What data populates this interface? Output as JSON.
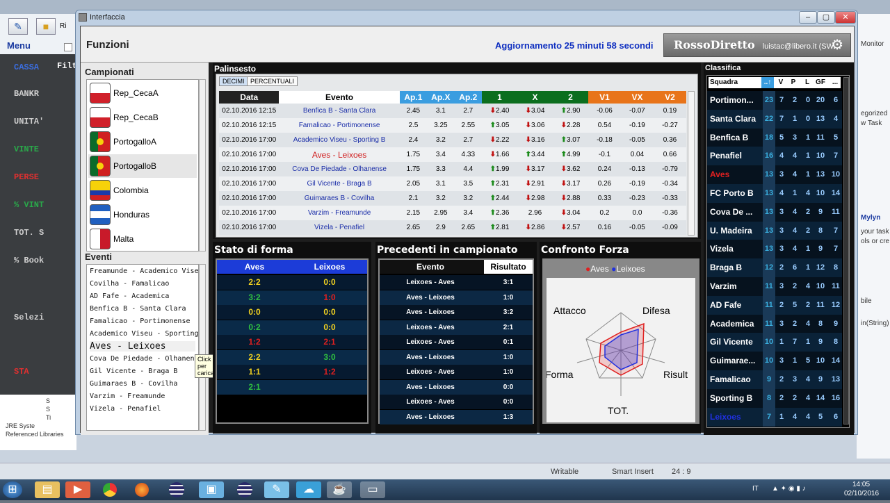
{
  "ide": {
    "menu_label": "Menu",
    "tab_fragment": "Ri",
    "filter_fragment": "Filt",
    "left_items": [
      "CASSA",
      "BANKR",
      "UNITA'",
      "VINTE",
      "PERSE",
      "% VINT",
      "TOT. S",
      "% Book",
      "Selezi",
      "STA"
    ],
    "left_colors": [
      "#3b6ee0",
      "#cfcfcf",
      "#cfcfcf",
      "#2aa84a",
      "#e03030",
      "#2aa84a",
      "#cfcfcf",
      "#cfcfcf",
      "#cfcfcf",
      "#e03030"
    ],
    "explorer_items": [
      "S",
      "S",
      "Ti",
      "JRE Syste",
      "Referenced Libraries"
    ],
    "right_items": [
      "Monitor",
      "egorized",
      "w Task",
      "Mylyn",
      "your task",
      "ols or cre",
      "bile",
      "in(String)"
    ],
    "status": {
      "writable": "Writable",
      "insert": "Smart Insert",
      "position": "24 : 9"
    },
    "clock": {
      "time": "14:05",
      "date": "02/10/2016",
      "lang": "IT"
    }
  },
  "window": {
    "title": "Interfaccia",
    "buttons": [
      "–",
      "▢",
      "✕"
    ],
    "funzioni": "Funzioni",
    "aggiornamento": "Aggiornamento 25 minuti 58 secondi",
    "logo": "RossoDiretto",
    "email": "luistac@libero.it (SW. Lab.)"
  },
  "campionati": {
    "label": "Campionati",
    "items": [
      {
        "name": "Rep_CecaA",
        "flag": "cz"
      },
      {
        "name": "Rep_CecaB",
        "flag": "cz"
      },
      {
        "name": "PortogalloA",
        "flag": "pt"
      },
      {
        "name": "PortogalloB",
        "flag": "pt",
        "selected": true
      },
      {
        "name": "Colombia",
        "flag": "co"
      },
      {
        "name": "Honduras",
        "flag": "hn"
      },
      {
        "name": "Malta",
        "flag": "mt"
      }
    ]
  },
  "eventi": {
    "label": "Eventi",
    "items": [
      "Freamunde - Academico Visei",
      "Covilha - Famalicao",
      "AD Fafe - Academica",
      "Benfica B - Santa Clara",
      "Famalicao - Portimonense",
      "Academico Viseu - Sporting",
      "Aves - Leixoes",
      "Cova De Piedade - Olhanense",
      "Gil Vicente - Braga B",
      "Guimaraes B - Covilha",
      "Varzim - Freamunde",
      "Vizela - Penafiel"
    ],
    "selected": 6,
    "tooltip": "Click per caricare"
  },
  "palinsesto": {
    "title": "Palinsesto",
    "tabs": [
      "DECIMI",
      "PERCENTUALI"
    ],
    "headers": [
      "Data",
      "Evento",
      "Ap.1",
      "Ap.X",
      "Ap.2",
      "1",
      "X",
      "2",
      "V1",
      "VX",
      "V2"
    ],
    "rows": [
      {
        "data": "02.10.2016 12:15",
        "evento": "Benfica B - Santa Clara",
        "ap1": "2.45",
        "apx": "3.1",
        "ap2": "2.7",
        "o1": "2.40",
        "d1": "dn",
        "ox": "3.04",
        "dx": "dn",
        "o2": "2.90",
        "d2": "up",
        "v1": "-0.06",
        "vx": "-0.07",
        "v2": "0.19"
      },
      {
        "data": "02.10.2016 12:15",
        "evento": "Famalicao - Portimonense",
        "ap1": "2.5",
        "apx": "3.25",
        "ap2": "2.55",
        "o1": "3.05",
        "d1": "up",
        "ox": "3.06",
        "dx": "dn",
        "o2": "2.28",
        "d2": "dn",
        "v1": "0.54",
        "vx": "-0.19",
        "v2": "-0.27"
      },
      {
        "data": "02.10.2016 17:00",
        "evento": "Academico Viseu - Sporting B",
        "ap1": "2.4",
        "apx": "3.2",
        "ap2": "2.7",
        "o1": "2.22",
        "d1": "dn",
        "ox": "3.16",
        "dx": "dn",
        "o2": "3.07",
        "d2": "up",
        "v1": "-0.18",
        "vx": "-0.05",
        "v2": "0.36"
      },
      {
        "data": "02.10.2016 17:00",
        "evento": "Aves - Leixoes",
        "red": true,
        "ap1": "1.75",
        "apx": "3.4",
        "ap2": "4.33",
        "o1": "1.66",
        "d1": "dn",
        "ox": "3.44",
        "dx": "up",
        "o2": "4.99",
        "d2": "up",
        "v1": "-0.1",
        "vx": "0.04",
        "v2": "0.66"
      },
      {
        "data": "02.10.2016 17:00",
        "evento": "Cova De Piedade - Olhanense",
        "ap1": "1.75",
        "apx": "3.3",
        "ap2": "4.4",
        "o1": "1.99",
        "d1": "up",
        "ox": "3.17",
        "dx": "dn",
        "o2": "3.62",
        "d2": "dn",
        "v1": "0.24",
        "vx": "-0.13",
        "v2": "-0.79"
      },
      {
        "data": "02.10.2016 17:00",
        "evento": "Gil Vicente - Braga B",
        "ap1": "2.05",
        "apx": "3.1",
        "ap2": "3.5",
        "o1": "2.31",
        "d1": "up",
        "ox": "2.91",
        "dx": "dn",
        "o2": "3.17",
        "d2": "dn",
        "v1": "0.26",
        "vx": "-0.19",
        "v2": "-0.34"
      },
      {
        "data": "02.10.2016 17:00",
        "evento": "Guimaraes B - Covilha",
        "ap1": "2.1",
        "apx": "3.2",
        "ap2": "3.2",
        "o1": "2.44",
        "d1": "up",
        "ox": "2.98",
        "dx": "dn",
        "o2": "2.88",
        "d2": "dn",
        "v1": "0.33",
        "vx": "-0.23",
        "v2": "-0.33"
      },
      {
        "data": "02.10.2016 17:00",
        "evento": "Varzim - Freamunde",
        "ap1": "2.15",
        "apx": "2.95",
        "ap2": "3.4",
        "o1": "2.36",
        "d1": "up",
        "ox": "2.96",
        "dx": "",
        "o2": "3.04",
        "d2": "dn",
        "v1": "0.2",
        "vx": "0.0",
        "v2": "-0.36"
      },
      {
        "data": "02.10.2016 17:00",
        "evento": "Vizela - Penafiel",
        "ap1": "2.65",
        "apx": "2.9",
        "ap2": "2.65",
        "o1": "2.81",
        "d1": "up",
        "ox": "2.86",
        "dx": "dn",
        "o2": "2.57",
        "d2": "dn",
        "v1": "0.16",
        "vx": "-0.05",
        "v2": "-0.09"
      }
    ]
  },
  "stato_forma": {
    "title": "Stato di forma",
    "headers": [
      "Aves",
      "Leixoes"
    ],
    "rows": [
      {
        "a": "2:2",
        "ac": "#f0d020",
        "b": "0:0",
        "bc": "#f0d020"
      },
      {
        "a": "3:2",
        "ac": "#30c040",
        "b": "1:0",
        "bc": "#e02020"
      },
      {
        "a": "0:0",
        "ac": "#f0d020",
        "b": "0:0",
        "bc": "#f0d020"
      },
      {
        "a": "0:2",
        "ac": "#30c040",
        "b": "0:0",
        "bc": "#f0d020"
      },
      {
        "a": "1:2",
        "ac": "#e02020",
        "b": "2:1",
        "bc": "#e02020"
      },
      {
        "a": "2:2",
        "ac": "#f0d020",
        "b": "3:0",
        "bc": "#30c040"
      },
      {
        "a": "1:1",
        "ac": "#f0d020",
        "b": "1:2",
        "bc": "#e02020"
      },
      {
        "a": "2:1",
        "ac": "#30c040",
        "b": "",
        "bc": "#f0d020"
      }
    ]
  },
  "precedenti": {
    "title": "Precedenti in campionato",
    "headers": [
      "Evento",
      "Risultato"
    ],
    "rows": [
      {
        "e": "Leixoes - Aves",
        "r": "3:1"
      },
      {
        "e": "Aves - Leixoes",
        "r": "1:0"
      },
      {
        "e": "Aves - Leixoes",
        "r": "3:2"
      },
      {
        "e": "Leixoes - Aves",
        "r": "2:1"
      },
      {
        "e": "Leixoes - Aves",
        "r": "0:1"
      },
      {
        "e": "Aves - Leixoes",
        "r": "1:0"
      },
      {
        "e": "Leixoes - Aves",
        "r": "1:0"
      },
      {
        "e": "Aves - Leixoes",
        "r": "0:0"
      },
      {
        "e": "Leixoes - Aves",
        "r": "0:0"
      },
      {
        "e": "Aves - Leixoes",
        "r": "1:3"
      }
    ]
  },
  "confronto": {
    "title": "Confronto Forza",
    "legend": [
      "Aves",
      "Leixoes"
    ],
    "axes": [
      "Difesa",
      "Risult",
      "TOT.",
      "Forma",
      "Attacco"
    ],
    "colors": {
      "Aves": "#e02020",
      "Leixoes": "#2030e0"
    }
  },
  "classifica": {
    "title": "Classifica",
    "headers": [
      "Squadra",
      "..↑",
      "V",
      "P",
      "L",
      "GF",
      "..."
    ],
    "rows": [
      {
        "n": "Portimon...",
        "p": "23",
        "v": "7",
        "pa": "2",
        "l": "0",
        "gf": "20",
        "x": "6"
      },
      {
        "n": "Santa Clara",
        "p": "22",
        "v": "7",
        "pa": "1",
        "l": "0",
        "gf": "13",
        "x": "4"
      },
      {
        "n": "Benfica B",
        "p": "18",
        "v": "5",
        "pa": "3",
        "l": "1",
        "gf": "11",
        "x": "5"
      },
      {
        "n": "Penafiel",
        "p": "16",
        "v": "4",
        "pa": "4",
        "l": "1",
        "gf": "10",
        "x": "7"
      },
      {
        "n": "Aves",
        "p": "13",
        "v": "3",
        "pa": "4",
        "l": "1",
        "gf": "13",
        "x": "10",
        "red": true
      },
      {
        "n": "FC Porto B",
        "p": "13",
        "v": "4",
        "pa": "1",
        "l": "4",
        "gf": "10",
        "x": "14"
      },
      {
        "n": "Cova De ...",
        "p": "13",
        "v": "3",
        "pa": "4",
        "l": "2",
        "gf": "9",
        "x": "11"
      },
      {
        "n": "U. Madeira",
        "p": "13",
        "v": "3",
        "pa": "4",
        "l": "2",
        "gf": "8",
        "x": "7"
      },
      {
        "n": "Vizela",
        "p": "13",
        "v": "3",
        "pa": "4",
        "l": "1",
        "gf": "9",
        "x": "7"
      },
      {
        "n": "Braga B",
        "p": "12",
        "v": "2",
        "pa": "6",
        "l": "1",
        "gf": "12",
        "x": "8"
      },
      {
        "n": "Varzim",
        "p": "11",
        "v": "3",
        "pa": "2",
        "l": "4",
        "gf": "10",
        "x": "11"
      },
      {
        "n": "AD Fafe",
        "p": "11",
        "v": "2",
        "pa": "5",
        "l": "2",
        "gf": "11",
        "x": "12"
      },
      {
        "n": "Academica",
        "p": "11",
        "v": "3",
        "pa": "2",
        "l": "4",
        "gf": "8",
        "x": "9"
      },
      {
        "n": "Gil Vicente",
        "p": "10",
        "v": "1",
        "pa": "7",
        "l": "1",
        "gf": "9",
        "x": "8"
      },
      {
        "n": "Guimarae...",
        "p": "10",
        "v": "3",
        "pa": "1",
        "l": "5",
        "gf": "10",
        "x": "14"
      },
      {
        "n": "Famalicao",
        "p": "9",
        "v": "2",
        "pa": "3",
        "l": "4",
        "gf": "9",
        "x": "13"
      },
      {
        "n": "Sporting B",
        "p": "8",
        "v": "2",
        "pa": "2",
        "l": "4",
        "gf": "14",
        "x": "16"
      },
      {
        "n": "Leixoes",
        "p": "7",
        "v": "1",
        "pa": "4",
        "l": "4",
        "gf": "5",
        "x": "6",
        "blue": true
      }
    ]
  }
}
